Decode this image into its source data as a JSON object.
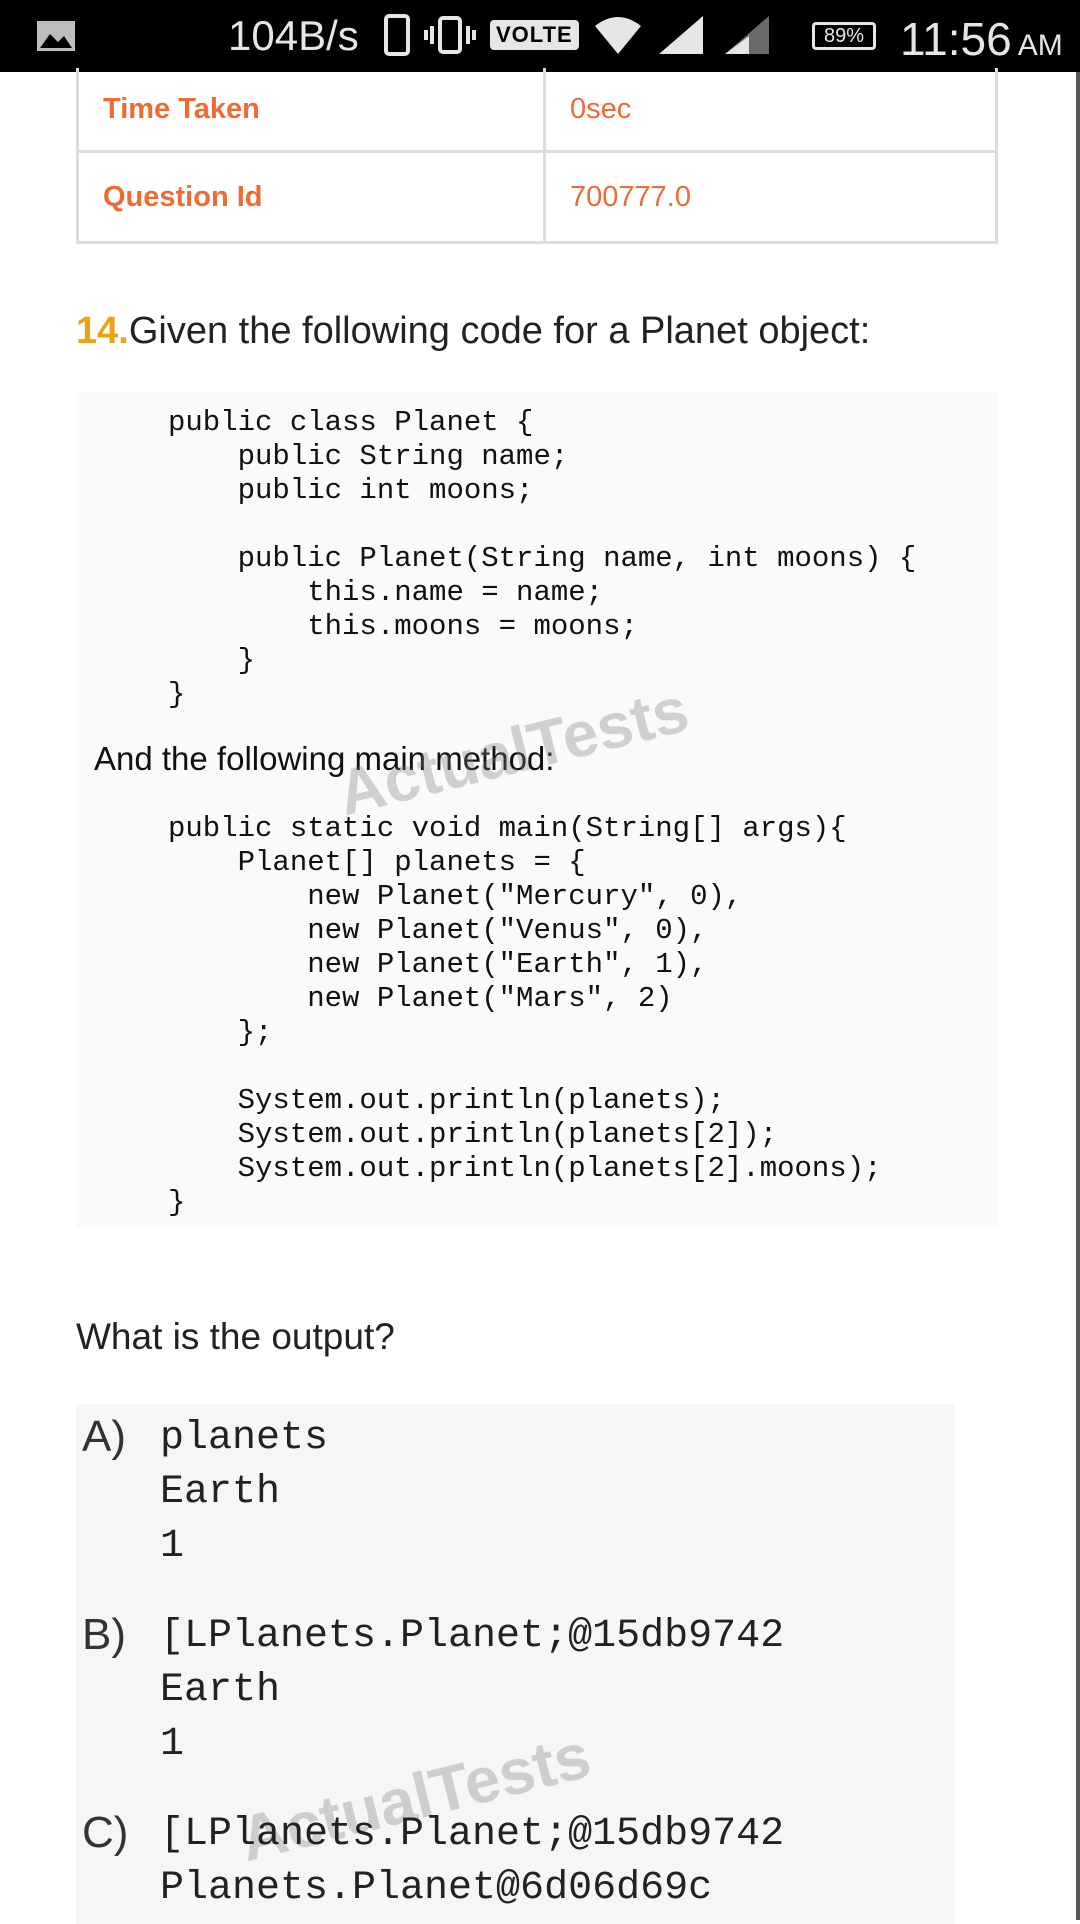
{
  "status_bar": {
    "net_speed": "104B/s",
    "volte": "VOLTE",
    "battery": "89%",
    "time": "11:56",
    "ampm": "AM"
  },
  "info_table": [
    {
      "label": "Time Taken",
      "value": "0sec"
    },
    {
      "label": "Question Id",
      "value": "700777.0"
    }
  ],
  "question": {
    "number": "14.",
    "text": "Given the following code for a Planet object:"
  },
  "code_image": {
    "code1": "public class Planet {\n    public String name;\n    public int moons;\n\n    public Planet(String name, int moons) {\n        this.name = name;\n        this.moons = moons;\n    }\n}",
    "sentence": "And the following main method:",
    "code2": "public static void main(String[] args){\n    Planet[] planets = {\n        new Planet(\"Mercury\", 0),\n        new Planet(\"Venus\", 0),\n        new Planet(\"Earth\", 1),\n        new Planet(\"Mars\", 2)\n    };\n\n    System.out.println(planets);\n    System.out.println(planets[2]);\n    System.out.println(planets[2].moons);\n}",
    "watermark": "ActualTests"
  },
  "prompt": "What is the output?",
  "options": [
    {
      "letter": "A)",
      "text": "planets\nEarth\n1"
    },
    {
      "letter": "B)",
      "text": "[LPlanets.Planet;@15db9742\nEarth\n1"
    },
    {
      "letter": "C)",
      "text": "[LPlanets.Planet;@15db9742\nPlanets.Planet@6d06d69c"
    }
  ],
  "colors": {
    "accent_orange": "#ee6b34",
    "question_number": "#e8a317"
  }
}
